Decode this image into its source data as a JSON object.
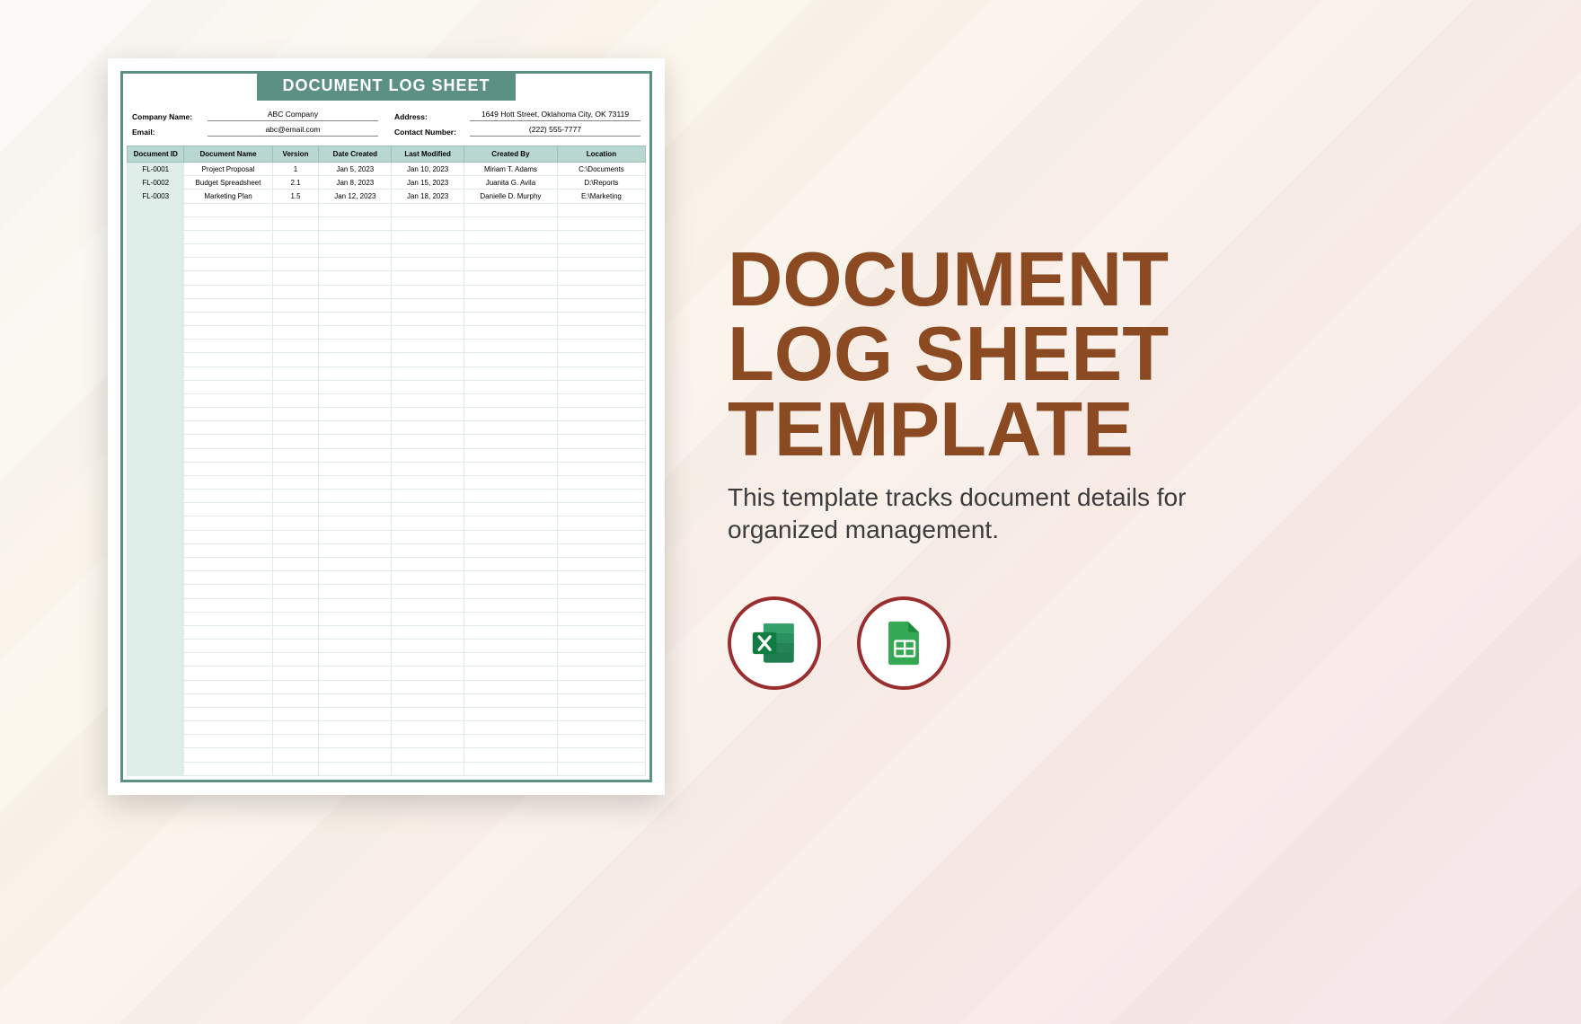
{
  "sheet": {
    "title": "DOCUMENT LOG SHEET",
    "fields": {
      "company_label": "Company Name:",
      "company_value": "ABC Company",
      "address_label": "Address:",
      "address_value": "1649 Hott Street, Oklahoma City, OK 73119",
      "email_label": "Email:",
      "email_value": "abc@email.com",
      "contact_label": "Contact Number:",
      "contact_value": "(222) 555-7777"
    },
    "columns": [
      "Document ID",
      "Document Name",
      "Version",
      "Date Created",
      "Last Modified",
      "Created By",
      "Location"
    ],
    "rows": [
      {
        "id": "FL-0001",
        "name": "Project Proposal",
        "version": "1",
        "created": "Jan 5, 2023",
        "modified": "Jan 10, 2023",
        "author": "Miriam T. Adams",
        "location": "C:\\Documents"
      },
      {
        "id": "FL-0002",
        "name": "Budget Spreadsheet",
        "version": "2.1",
        "created": "Jan 8, 2023",
        "modified": "Jan 15, 2023",
        "author": "Juanita G. Avila",
        "location": "D:\\Reports"
      },
      {
        "id": "FL-0003",
        "name": "Marketing Plan",
        "version": "1.5",
        "created": "Jan 12, 2023",
        "modified": "Jan 18, 2023",
        "author": "Danielle D. Murphy",
        "location": "E:\\Marketing"
      }
    ],
    "empty_rows": 42
  },
  "promo": {
    "title_line1": "DOCUMENT",
    "title_line2": "LOG SHEET",
    "title_line3": "TEMPLATE",
    "description": "This template tracks document details for organized management.",
    "icons": {
      "excel": "excel-icon",
      "sheets": "google-sheets-icon"
    }
  }
}
